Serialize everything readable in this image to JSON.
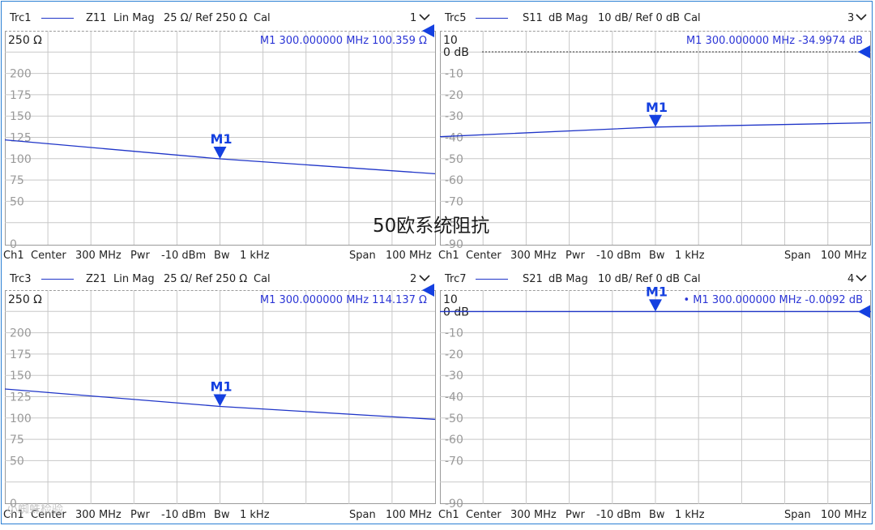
{
  "overlay_title": "50欧系统阻抗",
  "watermark": "小蜘蛛检验",
  "colors": {
    "trace": "#1f35c8",
    "marker": "#1440e0",
    "grid": "#c8c8c8",
    "refarrow": "#1440e0"
  },
  "panels": [
    {
      "id": "p1",
      "trc": "Trc1",
      "param": "Z11",
      "format": "Lin Mag",
      "scale": "25 Ω/ Ref 250 Ω",
      "cal": "Cal",
      "num": "1",
      "top_label": "250 Ω",
      "yticks": [
        "200",
        "175",
        "150",
        "125",
        "100",
        "75",
        "50",
        "",
        "0"
      ],
      "marker_readout": "M1  300.000000  MHz  100.359  Ω",
      "marker_label": "M1",
      "footer": {
        "ch": "Ch1",
        "center_l": "Center",
        "center_v": "300 MHz",
        "pwr_l": "Pwr",
        "pwr_v": "-10 dBm",
        "bw_l": "Bw",
        "bw_v": "1 kHz",
        "span_l": "Span",
        "span_v": "100 MHz"
      }
    },
    {
      "id": "p2",
      "trc": "Trc5",
      "param": "S11",
      "format": "dB Mag",
      "scale": "10 dB/ Ref 0 dB",
      "cal": "Cal",
      "num": "3",
      "top_label": "10",
      "ref_label": "0 dB",
      "yticks": [
        "-10",
        "-20",
        "-30",
        "-40",
        "-50",
        "-60",
        "-70",
        "-80",
        "-90"
      ],
      "marker_readout": "M1  300.000000  MHz  -34.9974  dB",
      "marker_label": "M1",
      "footer": {
        "ch": "Ch1",
        "center_l": "Center",
        "center_v": "300 MHz",
        "pwr_l": "Pwr",
        "pwr_v": "-10 dBm",
        "bw_l": "Bw",
        "bw_v": "1 kHz",
        "span_l": "Span",
        "span_v": "100 MHz"
      }
    },
    {
      "id": "p3",
      "trc": "Trc3",
      "param": "Z21",
      "format": "Lin Mag",
      "scale": "25 Ω/ Ref 250 Ω",
      "cal": "Cal",
      "num": "2",
      "top_label": "250 Ω",
      "yticks": [
        "200",
        "175",
        "150",
        "125",
        "100",
        "75",
        "50",
        "",
        "0"
      ],
      "marker_readout": "M1  300.000000  MHz  114.137  Ω",
      "marker_label": "M1",
      "footer": {
        "ch": "Ch1",
        "center_l": "Center",
        "center_v": "300 MHz",
        "pwr_l": "Pwr",
        "pwr_v": "-10 dBm",
        "bw_l": "Bw",
        "bw_v": "1 kHz",
        "span_l": "Span",
        "span_v": "100 MHz"
      }
    },
    {
      "id": "p4",
      "trc": "Trc7",
      "param": "S21",
      "format": "dB Mag",
      "scale": "10 dB/ Ref 0 dB",
      "cal": "Cal",
      "num": "4",
      "top_label": "10",
      "ref_label": "0 dB",
      "yticks": [
        "-10",
        "-20",
        "-30",
        "-40",
        "-50",
        "-60",
        "-70",
        "",
        "-90"
      ],
      "marker_readout": "• M1  300.000000  MHz  -0.0092  dB",
      "marker_label": "M1",
      "footer": {
        "ch": "Ch1",
        "center_l": "Center",
        "center_v": "300 MHz",
        "pwr_l": "Pwr",
        "pwr_v": "-10 dBm",
        "bw_l": "Bw",
        "bw_v": "1 kHz",
        "span_l": "Span",
        "span_v": "100 MHz"
      }
    }
  ],
  "trace_values": {
    "p1": {
      "start": 122.5,
      "marker": 100.359,
      "end": 83
    },
    "p2": {
      "start": -39.5,
      "marker": -34.9974,
      "end": -33
    },
    "p3": {
      "start": 134.5,
      "marker": 114.137,
      "end": 99
    },
    "p4": {
      "start": -0.0092,
      "marker": -0.0092,
      "end": -0.0092
    }
  }
}
